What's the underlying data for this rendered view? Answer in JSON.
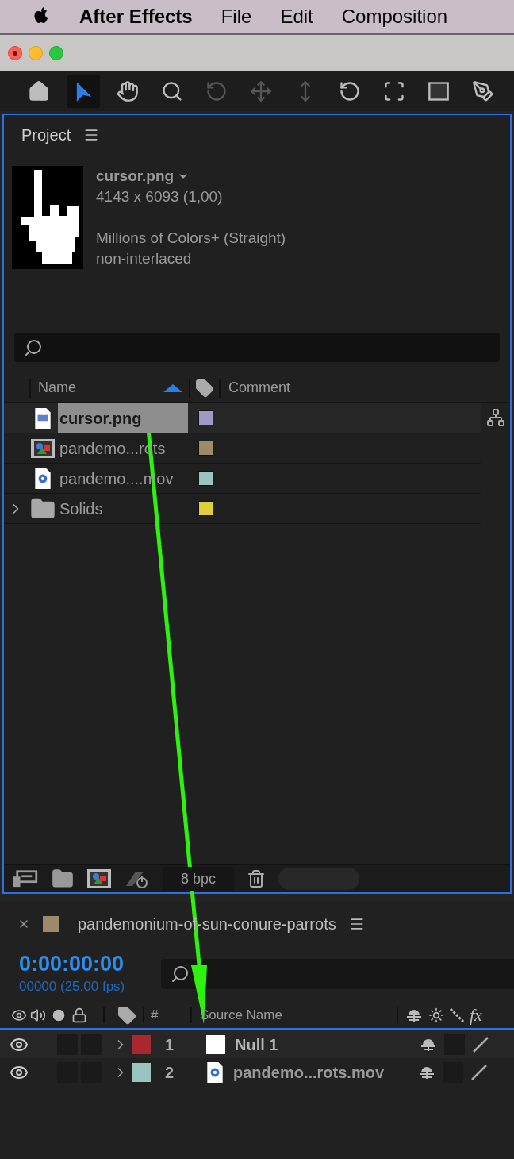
{
  "menubar": {
    "app_name": "After Effects",
    "items": [
      "File",
      "Edit",
      "Composition"
    ]
  },
  "toolbar": {
    "tools": [
      {
        "kind": "home",
        "selected": false
      },
      {
        "kind": "select",
        "selected": true
      },
      {
        "kind": "hand",
        "selected": false
      },
      {
        "kind": "zoom",
        "selected": false
      },
      {
        "kind": "orbit",
        "selected": false
      },
      {
        "kind": "move",
        "selected": false
      },
      {
        "kind": "dolly",
        "selected": false
      },
      {
        "kind": "rotate",
        "selected": false
      },
      {
        "kind": "anchor",
        "selected": false
      },
      {
        "kind": "shape",
        "selected": false
      },
      {
        "kind": "pen",
        "selected": false
      }
    ]
  },
  "project": {
    "title": "Project",
    "preview": {
      "name": "cursor.png",
      "dimensions": "4143 x 6093 (1,00)",
      "color_info": "Millions of Colors+ (Straight)",
      "interlace": "non-interlaced"
    },
    "columns": [
      "Name",
      "Comment"
    ],
    "items": [
      {
        "name": "cursor.png",
        "kind": "image",
        "color": "#9d9bc3",
        "selected": true
      },
      {
        "name": "pandemo...rots",
        "kind": "comp",
        "color": "#9c8a69",
        "selected": false
      },
      {
        "name": "pandemo....mov",
        "kind": "movie",
        "color": "#9ac5bf",
        "selected": false
      },
      {
        "name": "Solids",
        "kind": "folder",
        "color": "#e0cf3d",
        "selected": false
      }
    ],
    "bpc": "8 bpc"
  },
  "timeline": {
    "composition": {
      "name": "pandemonium-of-sun-conure-parrots",
      "color": "#9c8a69"
    },
    "timecode": "0:00:00:00",
    "frame_info": "00000 (25.00 fps)",
    "columns": [
      "#",
      "Source Name"
    ],
    "effects_label": "fx",
    "layers": [
      {
        "number": "1",
        "name": "Null 1",
        "kind": "null",
        "color": "#a9282f",
        "selected": true
      },
      {
        "number": "2",
        "name": "pandemo...rots.mov",
        "kind": "movie",
        "color": "#9ac5bf",
        "selected": false
      }
    ]
  }
}
